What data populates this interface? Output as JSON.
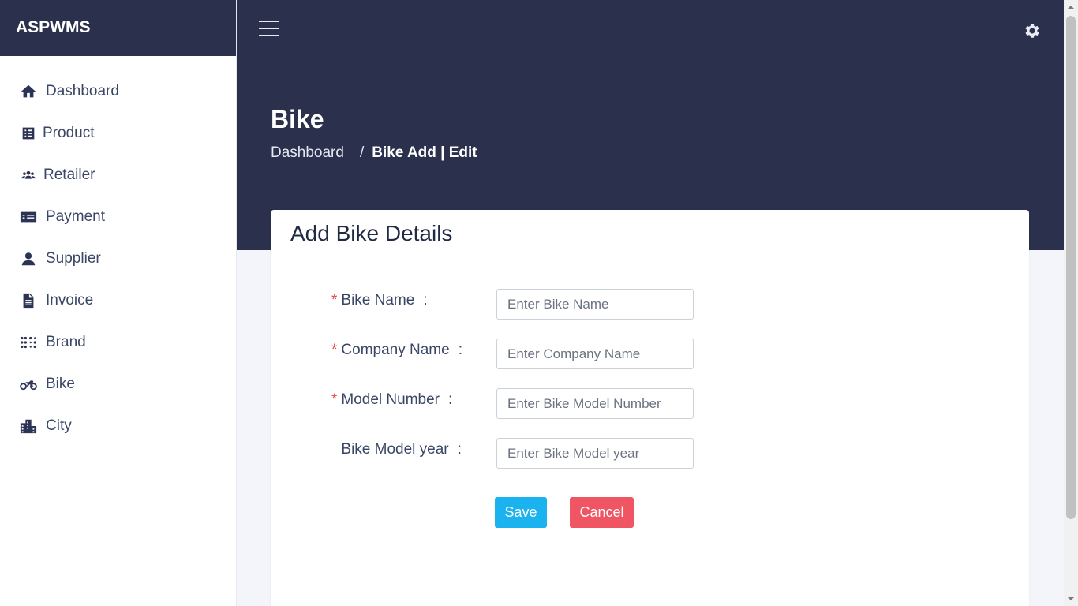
{
  "app": {
    "brand": "ASPWMS"
  },
  "sidebar": {
    "items": [
      {
        "label": "Dashboard",
        "icon": "home-icon"
      },
      {
        "label": "Product",
        "icon": "list-icon"
      },
      {
        "label": "Retailer",
        "icon": "users-icon"
      },
      {
        "label": "Payment",
        "icon": "money-check-icon"
      },
      {
        "label": "Supplier",
        "icon": "user-icon"
      },
      {
        "label": "Invoice",
        "icon": "file-icon"
      },
      {
        "label": "Brand",
        "icon": "braille-icon"
      },
      {
        "label": "Bike",
        "icon": "motorcycle-icon"
      },
      {
        "label": "City",
        "icon": "city-icon"
      }
    ]
  },
  "header": {
    "title": "Bike",
    "breadcrumb": {
      "home": "Dashboard",
      "separator": "/",
      "current": "Bike Add | Edit"
    }
  },
  "form": {
    "title": "Add Bike Details",
    "fields": [
      {
        "label": "Bike Name",
        "required": true,
        "placeholder": "Enter Bike Name",
        "value": ""
      },
      {
        "label": "Company Name",
        "required": true,
        "placeholder": "Enter Company Name",
        "value": ""
      },
      {
        "label": "Model Number",
        "required": true,
        "placeholder": "Enter Bike Model Number",
        "value": ""
      },
      {
        "label": "Bike Model year",
        "required": false,
        "placeholder": "Enter Bike Model year",
        "value": ""
      }
    ],
    "required_mark": "*",
    "colon": ":",
    "save_label": "Save",
    "cancel_label": "Cancel"
  },
  "colors": {
    "header_bg": "#2b304d",
    "save": "#1ab3f0",
    "cancel": "#ef5563",
    "required": "#e04a4a"
  }
}
